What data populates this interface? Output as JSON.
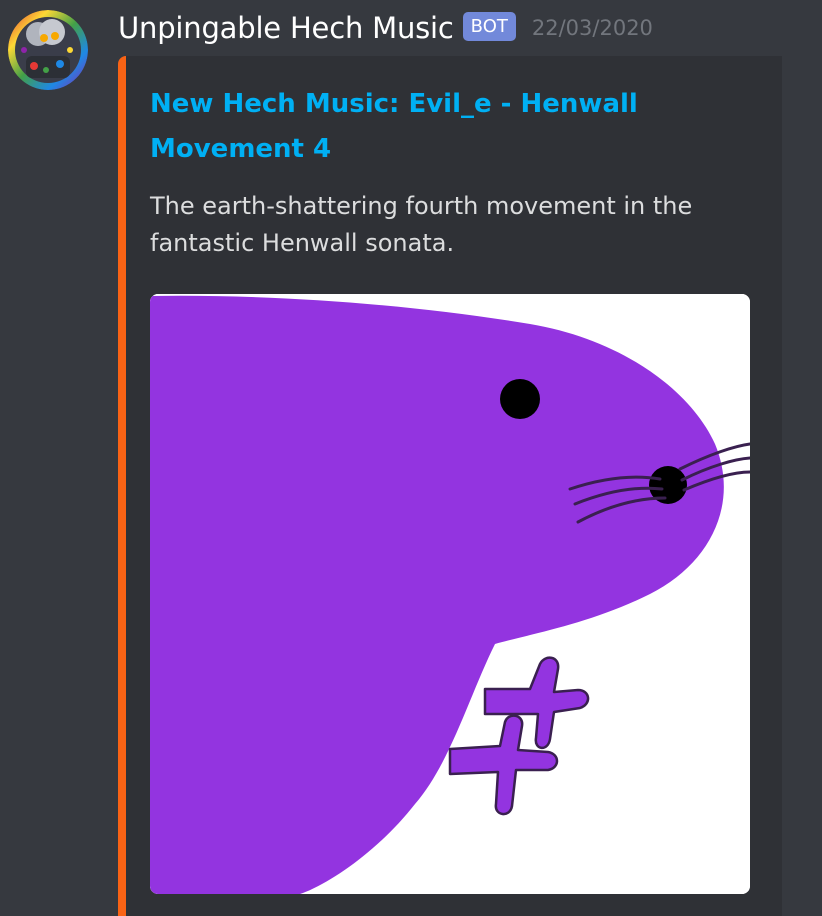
{
  "message": {
    "username": "Unpingable Hech Music",
    "bot_tag": "BOT",
    "timestamp": "22/03/2020"
  },
  "embed": {
    "accent_color": "#f96315",
    "title": "New Hech Music: Evil_e - Henwall Movement 4",
    "description": "The earth-shattering fourth movement in the fantastic Henwall sonata."
  },
  "colors": {
    "background": "#36393f",
    "embed_background": "#2f3136",
    "link": "#00b0f4",
    "bot_tag": "#7289da",
    "creature": "#9334e0"
  },
  "icons": {
    "avatar": "avatar-image",
    "embed_image": "purple-creature-image"
  }
}
